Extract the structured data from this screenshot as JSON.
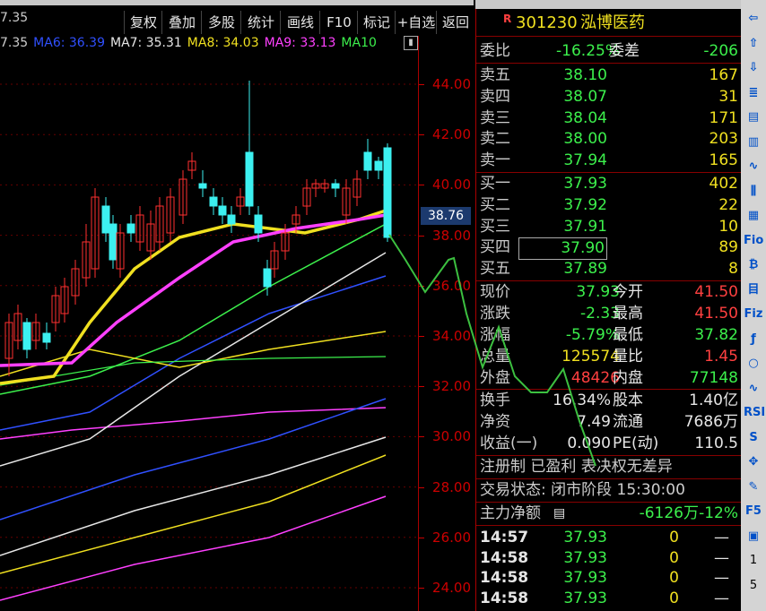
{
  "toolbar": {
    "buttons": [
      "复权",
      "叠加",
      "多股",
      "统计",
      "画线",
      "F10",
      "标记",
      "+自选",
      "返回"
    ],
    "left_fragment": "7.35"
  },
  "ma_legend": [
    {
      "label": "MA6: 36.39",
      "color": "#3050ff"
    },
    {
      "label": "MA7: 35.31",
      "color": "#e6e6e6"
    },
    {
      "label": "MA8: 34.03",
      "color": "#f0e020"
    },
    {
      "label": "MA9: 33.13",
      "color": "#ff40ff"
    },
    {
      "label": "MA10",
      "color": "#3cf04c"
    }
  ],
  "price_axis": {
    "labels": [
      "44.00",
      "42.00",
      "40.00",
      "38.00",
      "36.00",
      "34.00",
      "32.00",
      "30.00",
      "28.00",
      "26.00",
      "24.00"
    ],
    "current": "38.76"
  },
  "stock": {
    "code": "301230",
    "name": "泓博医药",
    "badge": "R"
  },
  "order_book": {
    "ratio_label": "委比",
    "ratio": "-16.25%",
    "diff_label": "委差",
    "diff": "-206",
    "asks": [
      {
        "label": "卖五",
        "price": "38.10",
        "vol": "167"
      },
      {
        "label": "卖四",
        "price": "38.07",
        "vol": "31"
      },
      {
        "label": "卖三",
        "price": "38.04",
        "vol": "171"
      },
      {
        "label": "卖二",
        "price": "38.00",
        "vol": "203"
      },
      {
        "label": "卖一",
        "price": "37.94",
        "vol": "165"
      }
    ],
    "bids": [
      {
        "label": "买一",
        "price": "37.93",
        "vol": "402"
      },
      {
        "label": "买二",
        "price": "37.92",
        "vol": "22"
      },
      {
        "label": "买三",
        "price": "37.91",
        "vol": "10"
      },
      {
        "label": "买四",
        "price": "37.90",
        "vol": "89"
      },
      {
        "label": "买五",
        "price": "37.89",
        "vol": "8"
      }
    ]
  },
  "quote": {
    "rows": [
      {
        "l1": "现价",
        "v1": "37.93",
        "c1": "green",
        "l2": "今开",
        "v2": "41.50",
        "c2": "red"
      },
      {
        "l1": "涨跌",
        "v1": "-2.33",
        "c1": "green",
        "l2": "最高",
        "v2": "41.50",
        "c2": "red"
      },
      {
        "l1": "涨幅",
        "v1": "-5.79%",
        "c1": "green",
        "l2": "最低",
        "v2": "37.82",
        "c2": "green"
      },
      {
        "l1": "总量",
        "v1": "125574",
        "c1": "yellow",
        "l2": "量比",
        "v2": "1.45",
        "c2": "red"
      },
      {
        "l1": "外盘",
        "v1": "48426",
        "c1": "red",
        "l2": "内盘",
        "v2": "77148",
        "c2": "green"
      }
    ],
    "rows2": [
      {
        "l1": "换手",
        "v1": "16.34%",
        "l2": "股本",
        "v2": "1.40亿"
      },
      {
        "l1": "净资",
        "v1": "7.49",
        "l2": "流通",
        "v2": "7686万"
      },
      {
        "l1": "收益(一)",
        "v1": "0.090",
        "l2": "PE(动)",
        "v2": "110.5"
      }
    ],
    "registration": "注册制 已盈利 表决权无差异",
    "trade_status": "交易状态: 闭市阶段 15:30:00",
    "main_flow_label": "主力净额",
    "main_flow_value": "-6126万",
    "main_flow_pct": "-12%"
  },
  "ticks": [
    {
      "time": "14:57",
      "price": "37.93",
      "vol": "0",
      "dir": "—"
    },
    {
      "time": "14:58",
      "price": "37.93",
      "vol": "0",
      "dir": "—"
    },
    {
      "time": "14:58",
      "price": "37.93",
      "vol": "0",
      "dir": "—"
    },
    {
      "time": "14:58",
      "price": "37.93",
      "vol": "0",
      "dir": "—"
    }
  ],
  "side_icons": [
    "⇦",
    "⇧",
    "⇩",
    "≣",
    "▤",
    "▥",
    "∿",
    "⫼",
    "▦",
    "Fio",
    "₿",
    "目",
    "Fiz",
    "ƒ",
    "○",
    "∿",
    "RSI",
    "S",
    "✥",
    "✎",
    "F5",
    "▣",
    "1",
    "5"
  ],
  "colors": {
    "up": "#ff4040",
    "down": "#3cf04c",
    "axis": "#c00000",
    "accent": "#3cf0f0"
  }
}
